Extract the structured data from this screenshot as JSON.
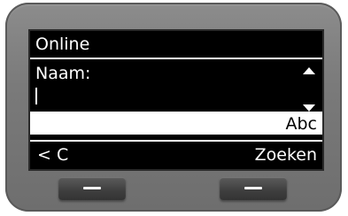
{
  "screen": {
    "title": "Online",
    "field_label": "Naam:",
    "input_value": "",
    "input_mode": "Abc",
    "scroll_up_icon": "triangle-up-icon",
    "scroll_down_icon": "triangle-down-icon"
  },
  "softkeys": {
    "left_label": "< C",
    "right_label": "Zoeken"
  },
  "colors": {
    "display_background": "#000000",
    "display_text": "#ffffff",
    "highlight_background": "#ffffff",
    "bezel": "#7a7a7a"
  }
}
